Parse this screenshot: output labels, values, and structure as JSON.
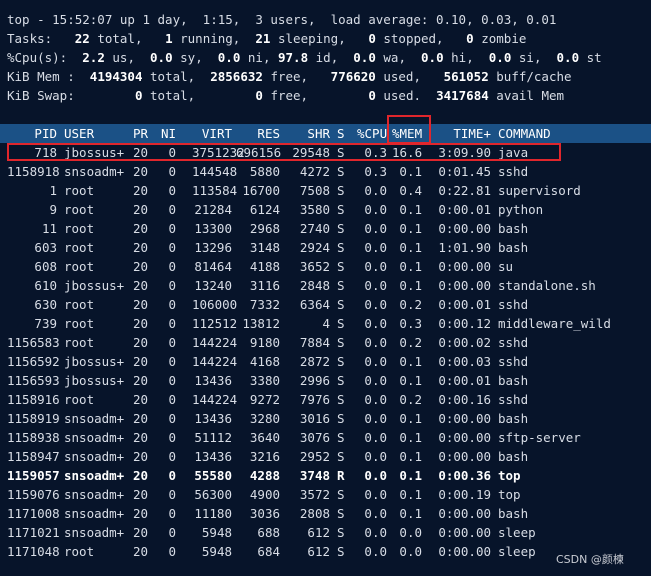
{
  "summary": {
    "line1": "top - 15:52:07 up 1 day,  1:15,  3 users,  load average: 0.10, 0.03, 0.01",
    "tasks": {
      "label": "Tasks:",
      "total": "22",
      "total_label": "total,",
      "running": "1",
      "running_label": "running,",
      "sleeping": "21",
      "sleeping_label": "sleeping,",
      "stopped": "0",
      "stopped_label": "stopped,",
      "zombie": "0",
      "zombie_label": "zombie"
    },
    "cpu": {
      "label": "%Cpu(s):",
      "us": "2.2",
      "us_label": "us,",
      "sy": "0.0",
      "sy_label": "sy,",
      "ni": "0.0",
      "ni_label": "ni,",
      "id": "97.8",
      "id_label": "id,",
      "wa": "0.0",
      "wa_label": "wa,",
      "hi": "0.0",
      "hi_label": "hi,",
      "si": "0.0",
      "si_label": "si,",
      "st": "0.0",
      "st_label": "st"
    },
    "mem": {
      "label": "KiB Mem :",
      "total": "4194304",
      "total_label": "total,",
      "free": "2856632",
      "free_label": "free,",
      "used": "776620",
      "used_label": "used,",
      "buff": "561052",
      "buff_label": "buff/cache"
    },
    "swap": {
      "label": "KiB Swap:",
      "total": "0",
      "total_label": "total,",
      "free": "0",
      "free_label": "free,",
      "used": "0",
      "used_label": "used.",
      "avail": "3417684",
      "avail_label": "avail Mem"
    }
  },
  "columns": {
    "pid": "PID",
    "user": "USER",
    "pr": "PR",
    "ni": "NI",
    "virt": "VIRT",
    "res": "RES",
    "shr": "SHR",
    "s": "S",
    "cpu": "%CPU",
    "mem": "%MEM",
    "time": "TIME+",
    "command": "COMMAND"
  },
  "processes": [
    {
      "pid": "718",
      "user": "jbossus+",
      "pr": "20",
      "ni": "0",
      "virt": "3751232",
      "res": "696156",
      "shr": "29548",
      "s": "S",
      "cpu": "0.3",
      "mem": "16.6",
      "time": "3:09.90",
      "command": "java"
    },
    {
      "pid": "1158918",
      "user": "snsoadm+",
      "pr": "20",
      "ni": "0",
      "virt": "144548",
      "res": "5880",
      "shr": "4272",
      "s": "S",
      "cpu": "0.3",
      "mem": "0.1",
      "time": "0:01.45",
      "command": "sshd"
    },
    {
      "pid": "1",
      "user": "root",
      "pr": "20",
      "ni": "0",
      "virt": "113584",
      "res": "16700",
      "shr": "7508",
      "s": "S",
      "cpu": "0.0",
      "mem": "0.4",
      "time": "0:22.81",
      "command": "supervisord"
    },
    {
      "pid": "9",
      "user": "root",
      "pr": "20",
      "ni": "0",
      "virt": "21284",
      "res": "6124",
      "shr": "3580",
      "s": "S",
      "cpu": "0.0",
      "mem": "0.1",
      "time": "0:00.01",
      "command": "python"
    },
    {
      "pid": "11",
      "user": "root",
      "pr": "20",
      "ni": "0",
      "virt": "13300",
      "res": "2968",
      "shr": "2740",
      "s": "S",
      "cpu": "0.0",
      "mem": "0.1",
      "time": "0:00.00",
      "command": "bash"
    },
    {
      "pid": "603",
      "user": "root",
      "pr": "20",
      "ni": "0",
      "virt": "13296",
      "res": "3148",
      "shr": "2924",
      "s": "S",
      "cpu": "0.0",
      "mem": "0.1",
      "time": "1:01.90",
      "command": "bash"
    },
    {
      "pid": "608",
      "user": "root",
      "pr": "20",
      "ni": "0",
      "virt": "81464",
      "res": "4188",
      "shr": "3652",
      "s": "S",
      "cpu": "0.0",
      "mem": "0.1",
      "time": "0:00.00",
      "command": "su"
    },
    {
      "pid": "610",
      "user": "jbossus+",
      "pr": "20",
      "ni": "0",
      "virt": "13240",
      "res": "3116",
      "shr": "2848",
      "s": "S",
      "cpu": "0.0",
      "mem": "0.1",
      "time": "0:00.00",
      "command": "standalone.sh"
    },
    {
      "pid": "630",
      "user": "root",
      "pr": "20",
      "ni": "0",
      "virt": "106000",
      "res": "7332",
      "shr": "6364",
      "s": "S",
      "cpu": "0.0",
      "mem": "0.2",
      "time": "0:00.01",
      "command": "sshd"
    },
    {
      "pid": "739",
      "user": "root",
      "pr": "20",
      "ni": "0",
      "virt": "112512",
      "res": "13812",
      "shr": "4",
      "s": "S",
      "cpu": "0.0",
      "mem": "0.3",
      "time": "0:00.12",
      "command": "middleware_wild"
    },
    {
      "pid": "1156583",
      "user": "root",
      "pr": "20",
      "ni": "0",
      "virt": "144224",
      "res": "9180",
      "shr": "7884",
      "s": "S",
      "cpu": "0.0",
      "mem": "0.2",
      "time": "0:00.02",
      "command": "sshd"
    },
    {
      "pid": "1156592",
      "user": "jbossus+",
      "pr": "20",
      "ni": "0",
      "virt": "144224",
      "res": "4168",
      "shr": "2872",
      "s": "S",
      "cpu": "0.0",
      "mem": "0.1",
      "time": "0:00.03",
      "command": "sshd"
    },
    {
      "pid": "1156593",
      "user": "jbossus+",
      "pr": "20",
      "ni": "0",
      "virt": "13436",
      "res": "3380",
      "shr": "2996",
      "s": "S",
      "cpu": "0.0",
      "mem": "0.1",
      "time": "0:00.01",
      "command": "bash"
    },
    {
      "pid": "1158916",
      "user": "root",
      "pr": "20",
      "ni": "0",
      "virt": "144224",
      "res": "9272",
      "shr": "7976",
      "s": "S",
      "cpu": "0.0",
      "mem": "0.2",
      "time": "0:00.16",
      "command": "sshd"
    },
    {
      "pid": "1158919",
      "user": "snsoadm+",
      "pr": "20",
      "ni": "0",
      "virt": "13436",
      "res": "3280",
      "shr": "3016",
      "s": "S",
      "cpu": "0.0",
      "mem": "0.1",
      "time": "0:00.00",
      "command": "bash"
    },
    {
      "pid": "1158938",
      "user": "snsoadm+",
      "pr": "20",
      "ni": "0",
      "virt": "51112",
      "res": "3640",
      "shr": "3076",
      "s": "S",
      "cpu": "0.0",
      "mem": "0.1",
      "time": "0:00.00",
      "command": "sftp-server"
    },
    {
      "pid": "1158947",
      "user": "snsoadm+",
      "pr": "20",
      "ni": "0",
      "virt": "13436",
      "res": "3216",
      "shr": "2952",
      "s": "S",
      "cpu": "0.0",
      "mem": "0.1",
      "time": "0:00.00",
      "command": "bash"
    },
    {
      "pid": "1159057",
      "user": "snsoadm+",
      "pr": "20",
      "ni": "0",
      "virt": "55580",
      "res": "4288",
      "shr": "3748",
      "s": "R",
      "cpu": "0.0",
      "mem": "0.1",
      "time": "0:00.36",
      "command": "top",
      "bold": true
    },
    {
      "pid": "1159076",
      "user": "snsoadm+",
      "pr": "20",
      "ni": "0",
      "virt": "56300",
      "res": "4900",
      "shr": "3572",
      "s": "S",
      "cpu": "0.0",
      "mem": "0.1",
      "time": "0:00.19",
      "command": "top"
    },
    {
      "pid": "1171008",
      "user": "snsoadm+",
      "pr": "20",
      "ni": "0",
      "virt": "11180",
      "res": "3036",
      "shr": "2808",
      "s": "S",
      "cpu": "0.0",
      "mem": "0.1",
      "time": "0:00.00",
      "command": "bash"
    },
    {
      "pid": "1171021",
      "user": "snsoadm+",
      "pr": "20",
      "ni": "0",
      "virt": "5948",
      "res": "688",
      "shr": "612",
      "s": "S",
      "cpu": "0.0",
      "mem": "0.0",
      "time": "0:00.00",
      "command": "sleep"
    },
    {
      "pid": "1171048",
      "user": "root",
      "pr": "20",
      "ni": "0",
      "virt": "5948",
      "res": "684",
      "shr": "612",
      "s": "S",
      "cpu": "0.0",
      "mem": "0.0",
      "time": "0:00.00",
      "command": "sleep"
    }
  ],
  "watermark": "CSDN @颜楝",
  "colors": {
    "background": "#07142a",
    "header_bar": "#1b5186",
    "text": "#d8dde6",
    "highlight_box": "#e0262c"
  }
}
